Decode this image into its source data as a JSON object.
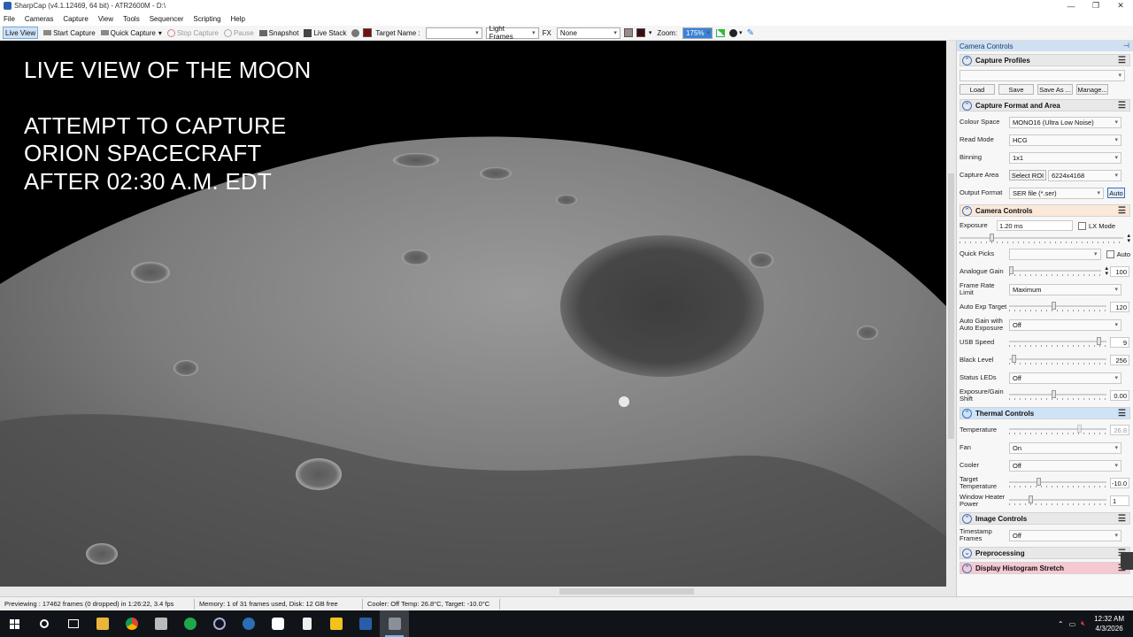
{
  "window": {
    "title": "SharpCap (v4.1.12469, 64 bit) - ATR2600M - D:\\",
    "controls": [
      "—",
      "❐",
      "✕"
    ]
  },
  "menu": [
    "File",
    "Cameras",
    "Capture",
    "View",
    "Tools",
    "Sequencer",
    "Scripting",
    "Help"
  ],
  "toolbar": {
    "live_view": "Live View",
    "start_capture": "Start Capture",
    "quick_capture": "Quick Capture",
    "stop_capture": "Stop Capture",
    "pause": "Pause",
    "snapshot": "Snapshot",
    "live_stack": "Live Stack",
    "target_name_label": "Target Name :",
    "target_name_value": "",
    "frame_type": "Light Frames",
    "fx_label": "FX",
    "fx_value": "None",
    "zoom_label": "Zoom:",
    "zoom_value": "175%"
  },
  "overlay": {
    "line1": "LIVE VIEW OF THE MOON",
    "line2": "ATTEMPT TO CAPTURE",
    "line3": "ORION SPACECRAFT",
    "line4": "AFTER 02:30 A.M. EDT"
  },
  "panel": {
    "header": "Camera Controls",
    "capture_profiles": {
      "title": "Capture Profiles",
      "profile_value": "",
      "buttons": [
        "Load",
        "Save",
        "Save As ...",
        "Manage..."
      ]
    },
    "capture_format": {
      "title": "Capture Format and Area",
      "colour_space_label": "Colour Space",
      "colour_space_value": "MONO16 (Ultra Low Noise)",
      "read_mode_label": "Read Mode",
      "read_mode_value": "HCG",
      "binning_label": "Binning",
      "binning_value": "1x1",
      "capture_area_label": "Capture Area",
      "select_roi": "Select ROI",
      "capture_area_value": "6224x4168",
      "output_format_label": "Output Format",
      "output_format_value": "SER file (*.ser)",
      "auto_button": "Auto"
    },
    "camera_controls": {
      "title": "Camera Controls",
      "exposure_label": "Exposure",
      "exposure_value": "1.20 ms",
      "lx_mode": "LX Mode",
      "quick_picks_label": "Quick Picks",
      "quick_picks_value": "",
      "auto_label": "Auto",
      "analogue_gain_label": "Analogue Gain",
      "analogue_gain_value": "100",
      "frame_rate_label": "Frame Rate Limit",
      "frame_rate_value": "Maximum",
      "auto_exp_target_label": "Auto Exp Target",
      "auto_exp_target_value": "120",
      "auto_gain_label": "Auto Gain with Auto Exposure",
      "auto_gain_value": "Off",
      "usb_speed_label": "USB Speed",
      "usb_speed_value": "9",
      "black_level_label": "Black Level",
      "black_level_value": "256",
      "status_leds_label": "Status LEDs",
      "status_leds_value": "Off",
      "exp_gain_shift_label": "Exposure/Gain Shift",
      "exp_gain_shift_value": "0.00"
    },
    "thermal_controls": {
      "title": "Thermal Controls",
      "temperature_label": "Temperature",
      "temperature_value": "26.8",
      "fan_label": "Fan",
      "fan_value": "On",
      "cooler_label": "Cooler",
      "cooler_value": "Off",
      "target_temp_label": "Target Temperature",
      "target_temp_value": "-10.0",
      "heater_label": "Window Heater Power",
      "heater_value": "1"
    },
    "image_controls": {
      "title": "Image Controls",
      "timestamp_label": "Timestamp Frames",
      "timestamp_value": "Off"
    },
    "preprocessing": {
      "title": "Preprocessing"
    },
    "histogram": {
      "title": "Display Histogram Stretch"
    }
  },
  "status": {
    "previewing": "Previewing : 17462 frames (0 dropped) in 1:26:22, 3.4 fps",
    "memory": "Memory: 1 of 31 frames used, Disk: 12 GB free",
    "cooler": "Cooler: Off Temp: 26.8°C, Target: -10.0°C"
  },
  "taskbar": {
    "time": "12:32 AM",
    "date": "4/3/2026",
    "apps": [
      "start-icon",
      "search-icon",
      "task-view-icon",
      "file-explorer-icon",
      "chrome-icon",
      "app-icon",
      "green-app-icon",
      "app-icon",
      "app-icon",
      "app-icon",
      "app-icon",
      "notepad-icon",
      "yellow-app-icon",
      "app-icon",
      "sharpcap-icon"
    ]
  },
  "colors": {
    "accent": "#3a6fbf",
    "thermal": "#cfe3f7",
    "camera_controls": "#fbe8d8",
    "histogram": "#f6c9d2"
  }
}
